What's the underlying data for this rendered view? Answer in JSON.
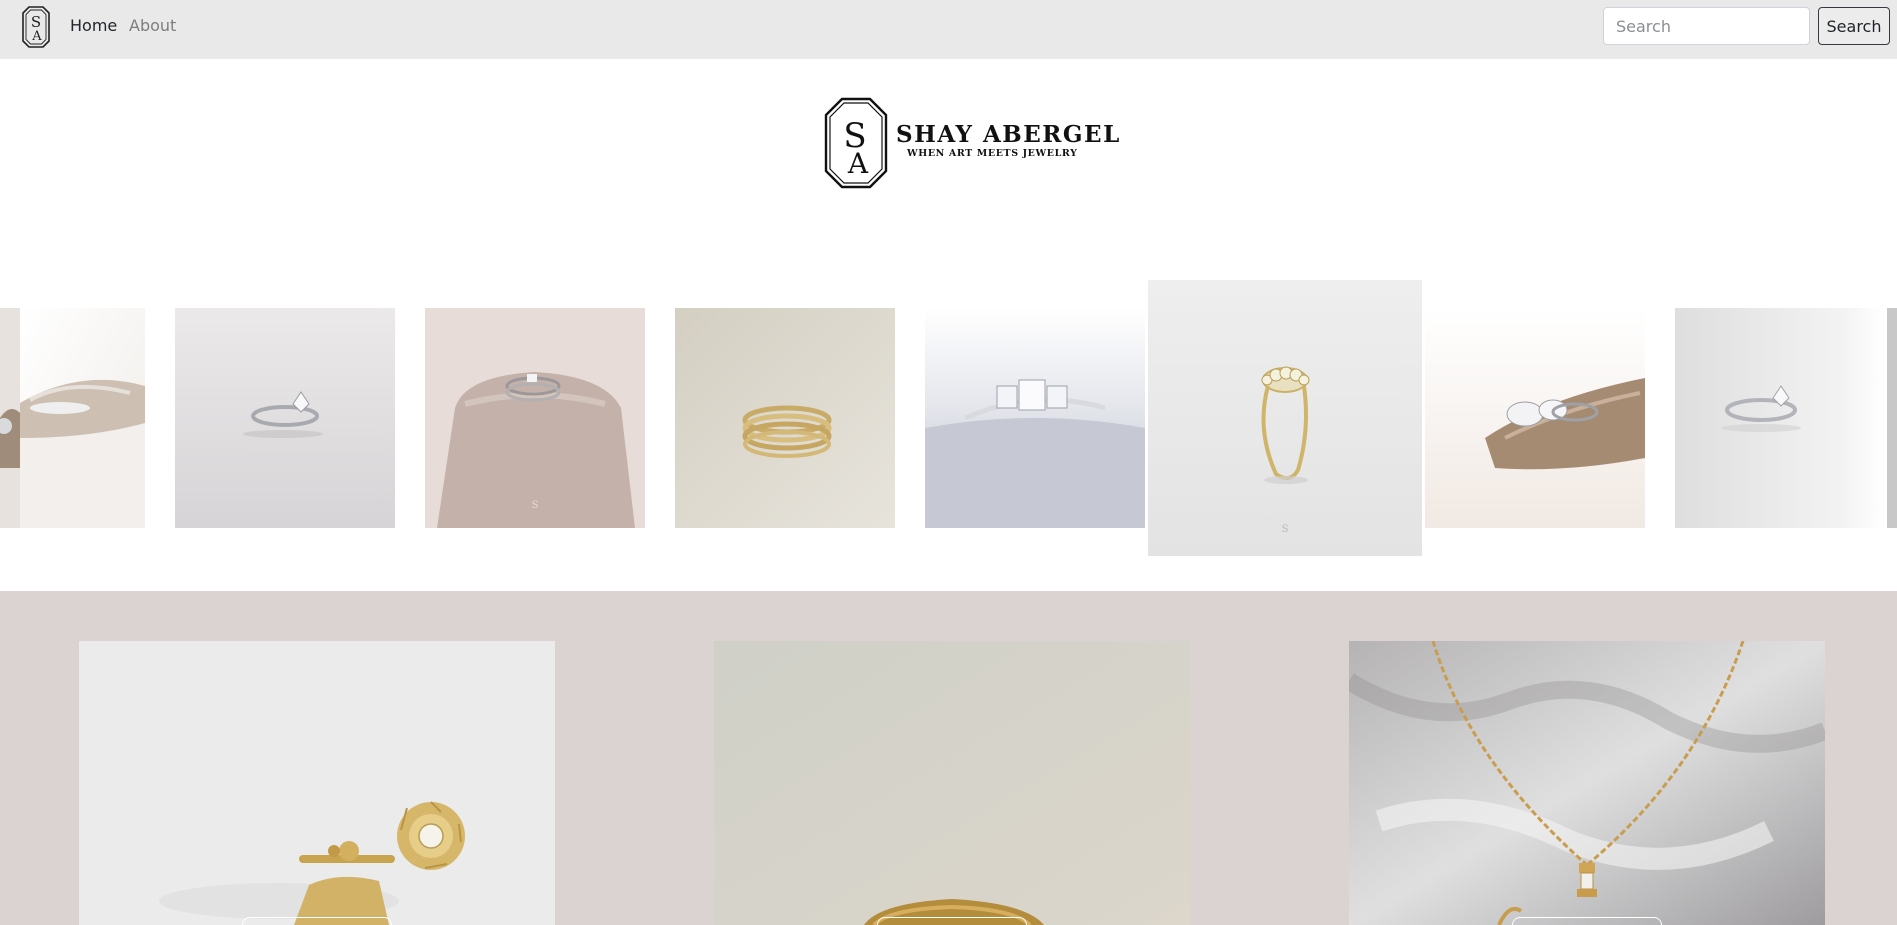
{
  "navbar": {
    "brand_icon": "sa-monogram-icon",
    "links": [
      {
        "label": "Home",
        "active": true
      },
      {
        "label": "About",
        "active": false
      }
    ],
    "search": {
      "placeholder": "Search",
      "value": "",
      "button_label": "Search"
    }
  },
  "brand": {
    "monogram_top": "S",
    "monogram_bottom": "A",
    "name": "SHAY ABERGEL",
    "tagline": "WHEN ART MEETS JEWELRY"
  },
  "carousel": {
    "images": [
      {
        "subject": "ring-on-stone"
      },
      {
        "subject": "silver-solitaire-ring"
      },
      {
        "subject": "ring-set-on-pedestal"
      },
      {
        "subject": "gold-stacked-bands"
      },
      {
        "subject": "emerald-cut-three-stone-ring"
      },
      {
        "subject": "gold-five-stone-ring",
        "active": true
      },
      {
        "subject": "pear-ring-on-stone"
      },
      {
        "subject": "silver-pave-ring"
      }
    ]
  },
  "featured": {
    "cards": [
      {
        "subject": "gold-flower-stud-earrings"
      },
      {
        "subject": "gold-ring-closeup"
      },
      {
        "subject": "gold-chain-pendant-necklace"
      }
    ]
  },
  "colors": {
    "navbar_bg": "#e9e9e9",
    "featured_bg": "#dbd2d2",
    "text_dark": "#212529",
    "text_muted": "#7d7d7d"
  }
}
